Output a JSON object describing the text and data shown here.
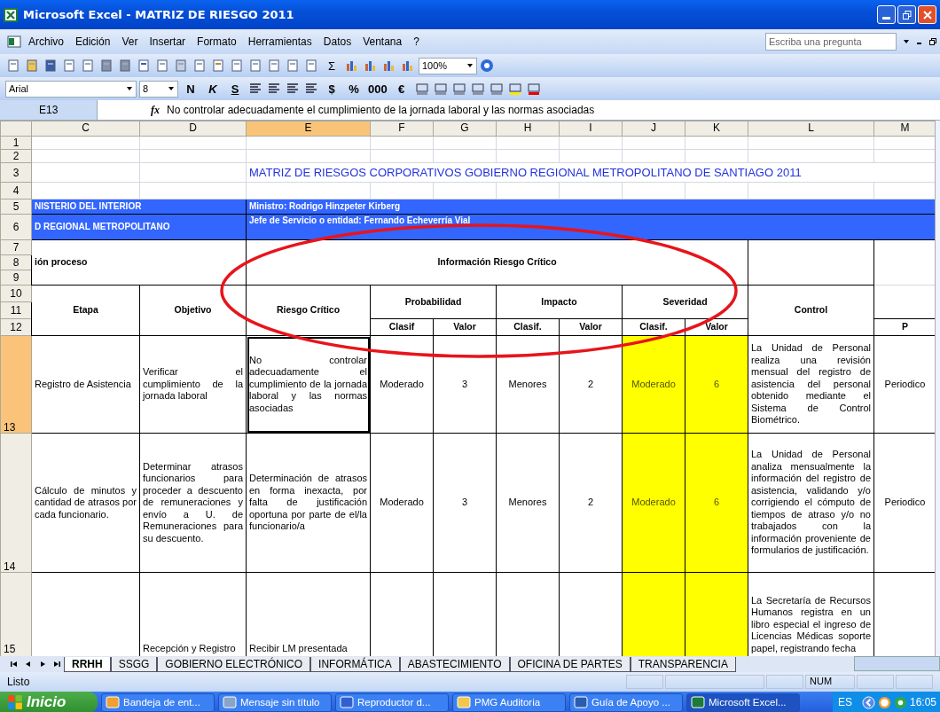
{
  "window": {
    "title": "Microsoft Excel - MATRIZ DE RIESGO 2011"
  },
  "menu": [
    "Archivo",
    "Edición",
    "Ver",
    "Insertar",
    "Formato",
    "Herramientas",
    "Datos",
    "Ventana",
    "?"
  ],
  "help_box": {
    "placeholder": "Escriba una pregunta"
  },
  "standard_toolbar": {
    "autosum": "Σ",
    "zoom": "100%"
  },
  "format_toolbar": {
    "font": "Arial",
    "size": "8",
    "style_buttons": [
      "N",
      "K",
      "S"
    ],
    "number_buttons": [
      "$",
      "%",
      "000",
      "€"
    ]
  },
  "formula_bar": {
    "cell_ref": "E13",
    "fx": "fx",
    "formula": "No controlar adecuadamente el cumplimiento de la jornada laboral y las normas asociadas"
  },
  "columns": [
    {
      "label": "C",
      "selected": false
    },
    {
      "label": "D",
      "selected": false
    },
    {
      "label": "E",
      "selected": true
    },
    {
      "label": "F",
      "selected": false
    },
    {
      "label": "G",
      "selected": false
    },
    {
      "label": "H",
      "selected": false
    },
    {
      "label": "I",
      "selected": false
    },
    {
      "label": "J",
      "selected": false
    },
    {
      "label": "K",
      "selected": false
    },
    {
      "label": "L",
      "selected": false
    },
    {
      "label": "M",
      "selected": false
    }
  ],
  "header_rows": [
    "1",
    "2",
    "3",
    "4",
    "5",
    "6",
    "7",
    "8",
    "9",
    "10",
    "11",
    "12"
  ],
  "sheet": {
    "title": "MATRIZ DE RIESGOS CORPORATIVOS GOBIERNO REGIONAL METROPOLITANO DE SANTIAGO 2011",
    "ministry": "NISTERIO DEL INTERIOR",
    "minister": "Ministro: Rodrigo Hinzpeter Kirberg",
    "region": "D REGIONAL METROPOLITANO",
    "chief": "Jefe de Servicio o entidad: Fernando Echeverría Vial",
    "process_header": "ión proceso",
    "risk_info_header": "Información Riesgo Crítico",
    "headers": {
      "etapa": "Etapa",
      "objetivo": "Objetivo",
      "riesgo": "Riesgo Crítico",
      "probabilidad": "Probabilidad",
      "impacto": "Impacto",
      "severidad": "Severidad",
      "control": "Control",
      "clasif_p": "Clasif",
      "valor_p": "Valor",
      "clasif_i": "Clasif.",
      "valor_i": "Valor",
      "clasif_s": "Clasif.",
      "valor_s": "Valor",
      "m": "P"
    }
  },
  "rows": [
    {
      "number": "13",
      "selected": true,
      "etapa": "Registro de Asistencia",
      "objetivo": "Verificar el cumplimiento de la jornada laboral",
      "riesgo": "No controlar adecuadamente el cumplimiento de la jornada laboral y las normas asociadas",
      "prob_clasif": "Moderado",
      "prob_valor": "3",
      "imp_clasif": "Menores",
      "imp_valor": "2",
      "sev_clasif": "Moderado",
      "sev_valor": "6",
      "control": "La Unidad de Personal realiza una revisión mensual del registro de asistencia del personal obtenido mediante el Sistema de Control Biométrico.",
      "m": "Periodico"
    },
    {
      "number": "14",
      "selected": false,
      "etapa": "Cálculo de minutos y cantidad de atrasos por cada funcionario.",
      "objetivo": "Determinar atrasos funcionarios para proceder a descuento de remuneraciones y envío a U. de Remuneraciones para su descuento.",
      "riesgo": "Determinación de atrasos en forma inexacta, por falta de justificación oportuna por parte de el/la funcionario/a",
      "prob_clasif": "Moderado",
      "prob_valor": "3",
      "imp_clasif": "Menores",
      "imp_valor": "2",
      "sev_clasif": "Moderado",
      "sev_valor": "6",
      "control": "La Unidad de Personal analiza mensualmente la información del registro de asistencia, validando y/o corrigiendo el cómputo de tiempos de atraso y/o no trabajados con la información proveniente de formularios de justificación.",
      "m": "Periodico"
    },
    {
      "number": "15",
      "selected": false,
      "objetivo": "Recepción y Registro",
      "riesgo": "Recibir LM presentada",
      "control": "La Secretaría de Recursos Humanos registra en un libro especial el ingreso de Licencias Médicas soporte papel, registrando fecha"
    }
  ],
  "sheet_tabs": [
    {
      "label": "RRHH",
      "selected": true
    },
    {
      "label": "SSGG",
      "selected": false
    },
    {
      "label": "GOBIERNO ELECTRÓNICO",
      "selected": false
    },
    {
      "label": "INFORMÁTICA",
      "selected": false
    },
    {
      "label": "ABASTECIMIENTO",
      "selected": false
    },
    {
      "label": "OFICINA DE PARTES",
      "selected": false
    },
    {
      "label": "TRANSPARENCIA",
      "selected": false
    }
  ],
  "status_bar": {
    "text": "Listo",
    "num": "NUM"
  },
  "taskbar": {
    "start": "Inicio",
    "tasks": [
      {
        "label": "Bandeja de ent...",
        "selected": false
      },
      {
        "label": "Mensaje sin título",
        "selected": false
      },
      {
        "label": "Reproductor d...",
        "selected": false
      },
      {
        "label": "PMG Auditoria",
        "selected": false
      },
      {
        "label": "Guía de Apoyo ...",
        "selected": false
      },
      {
        "label": "Microsoft Excel...",
        "selected": true
      }
    ],
    "language": "ES",
    "clock": "16:05"
  }
}
